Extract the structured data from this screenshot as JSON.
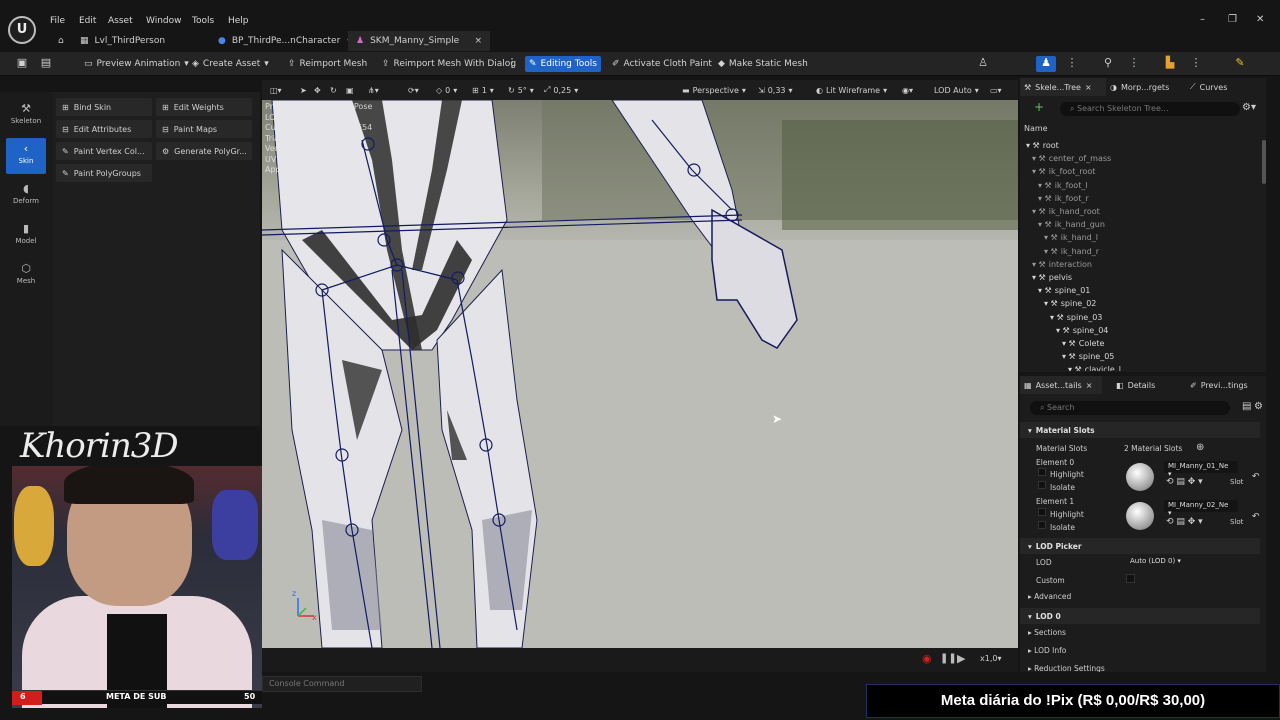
{
  "menu": [
    "File",
    "Edit",
    "Asset",
    "Window",
    "Tools",
    "Help"
  ],
  "doc_tabs": [
    {
      "label": "Lvl_ThirdPerson"
    },
    {
      "label": "BP_ThirdPe...nCharacter"
    },
    {
      "label": "SKM_Manny_Simple"
    }
  ],
  "toolbar": {
    "preview_animation": "Preview Animation",
    "create_asset": "Create Asset",
    "reimport_mesh": "Reimport Mesh",
    "reimport_dialog": "Reimport Mesh With Dialog",
    "editing_tools": "Editing Tools",
    "activate_cloth": "Activate Cloth Paint",
    "make_static": "Make Static Mesh"
  },
  "modes": [
    {
      "label": "Skeleton",
      "icon": "bone-icon"
    },
    {
      "label": "Skin",
      "icon": "skin-icon"
    },
    {
      "label": "Deform",
      "icon": "deform-icon"
    },
    {
      "label": "Model",
      "icon": "model-icon"
    },
    {
      "label": "Mesh",
      "icon": "mesh-icon"
    }
  ],
  "tools": {
    "bind_skin": "Bind Skin",
    "edit_weights": "Edit Weights",
    "edit_attributes": "Edit Attributes",
    "paint_maps": "Paint Maps",
    "paint_vertex": "Paint Vertex Col...",
    "generate_poly": "Generate PolyGr...",
    "paint_polygroups": "Paint PolyGroups"
  },
  "viewport": {
    "zero": "0",
    "one": "1",
    "five": "5°",
    "scale": "0,25",
    "perspective": "Perspective",
    "speed": "0,33",
    "view_mode": "Lit Wireframe",
    "lod": "LOD Auto",
    "stats": [
      "Previewing Reference Pose",
      "LOD: 0",
      "Current Screen Size: 2,654",
      "Triangles: 92.178",
      "Vertices: 48.706",
      "UV Channels: 1",
      "Approx Size: 117x44x181"
    ],
    "play_speed": "x1,0",
    "console_placeholder": "Console Command"
  },
  "skeleton_tree": {
    "tabs": [
      "Skele...Tree",
      "Morp...rgets",
      "Curves"
    ],
    "search_placeholder": "Search Skeleton Tree...",
    "column": "Name",
    "bones": [
      {
        "name": "root",
        "depth": 0,
        "dim": false
      },
      {
        "name": "center_of_mass",
        "depth": 1,
        "dim": true
      },
      {
        "name": "ik_foot_root",
        "depth": 1,
        "dim": true
      },
      {
        "name": "ik_foot_l",
        "depth": 2,
        "dim": true
      },
      {
        "name": "ik_foot_r",
        "depth": 2,
        "dim": true
      },
      {
        "name": "ik_hand_root",
        "depth": 1,
        "dim": true
      },
      {
        "name": "ik_hand_gun",
        "depth": 2,
        "dim": true
      },
      {
        "name": "ik_hand_l",
        "depth": 3,
        "dim": true
      },
      {
        "name": "ik_hand_r",
        "depth": 3,
        "dim": true
      },
      {
        "name": "interaction",
        "depth": 1,
        "dim": true
      },
      {
        "name": "pelvis",
        "depth": 1,
        "dim": false
      },
      {
        "name": "spine_01",
        "depth": 2,
        "dim": false
      },
      {
        "name": "spine_02",
        "depth": 3,
        "dim": false
      },
      {
        "name": "spine_03",
        "depth": 4,
        "dim": false
      },
      {
        "name": "spine_04",
        "depth": 5,
        "dim": false
      },
      {
        "name": "Colete",
        "depth": 6,
        "dim": false
      },
      {
        "name": "spine_05",
        "depth": 6,
        "dim": false
      },
      {
        "name": "clavicle_l",
        "depth": 7,
        "dim": false
      }
    ]
  },
  "details": {
    "tabs": [
      "Asset...tails",
      "Details",
      "Previ...tings"
    ],
    "search_placeholder": "Search",
    "material_slots_header": "Material Slots",
    "material_slots_label": "Material Slots",
    "material_slots_count": "2 Material Slots",
    "elements": [
      {
        "label": "Element 0",
        "material": "MI_Manny_01_Ne"
      },
      {
        "label": "Element 1",
        "material": "MI_Manny_02_Ne"
      }
    ],
    "highlight": "Highlight",
    "isolate": "Isolate",
    "slot": "Slot",
    "lod_picker": "LOD Picker",
    "lod_label": "LOD",
    "lod_value": "Auto (LOD 0)",
    "custom": "Custom",
    "advanced": "Advanced",
    "lod0": "LOD 0",
    "sections": "Sections",
    "lod_info": "LOD Info",
    "reduction": "Reduction Settings"
  },
  "webcam": {
    "banner": "Khorin3D",
    "meta_count": "6",
    "meta_label": "META DE SUB",
    "meta_goal": "50",
    "meta_progress": 0.12
  },
  "pix_banner": "Meta diária do !Pix (R$ 0,00/R$ 30,00)"
}
